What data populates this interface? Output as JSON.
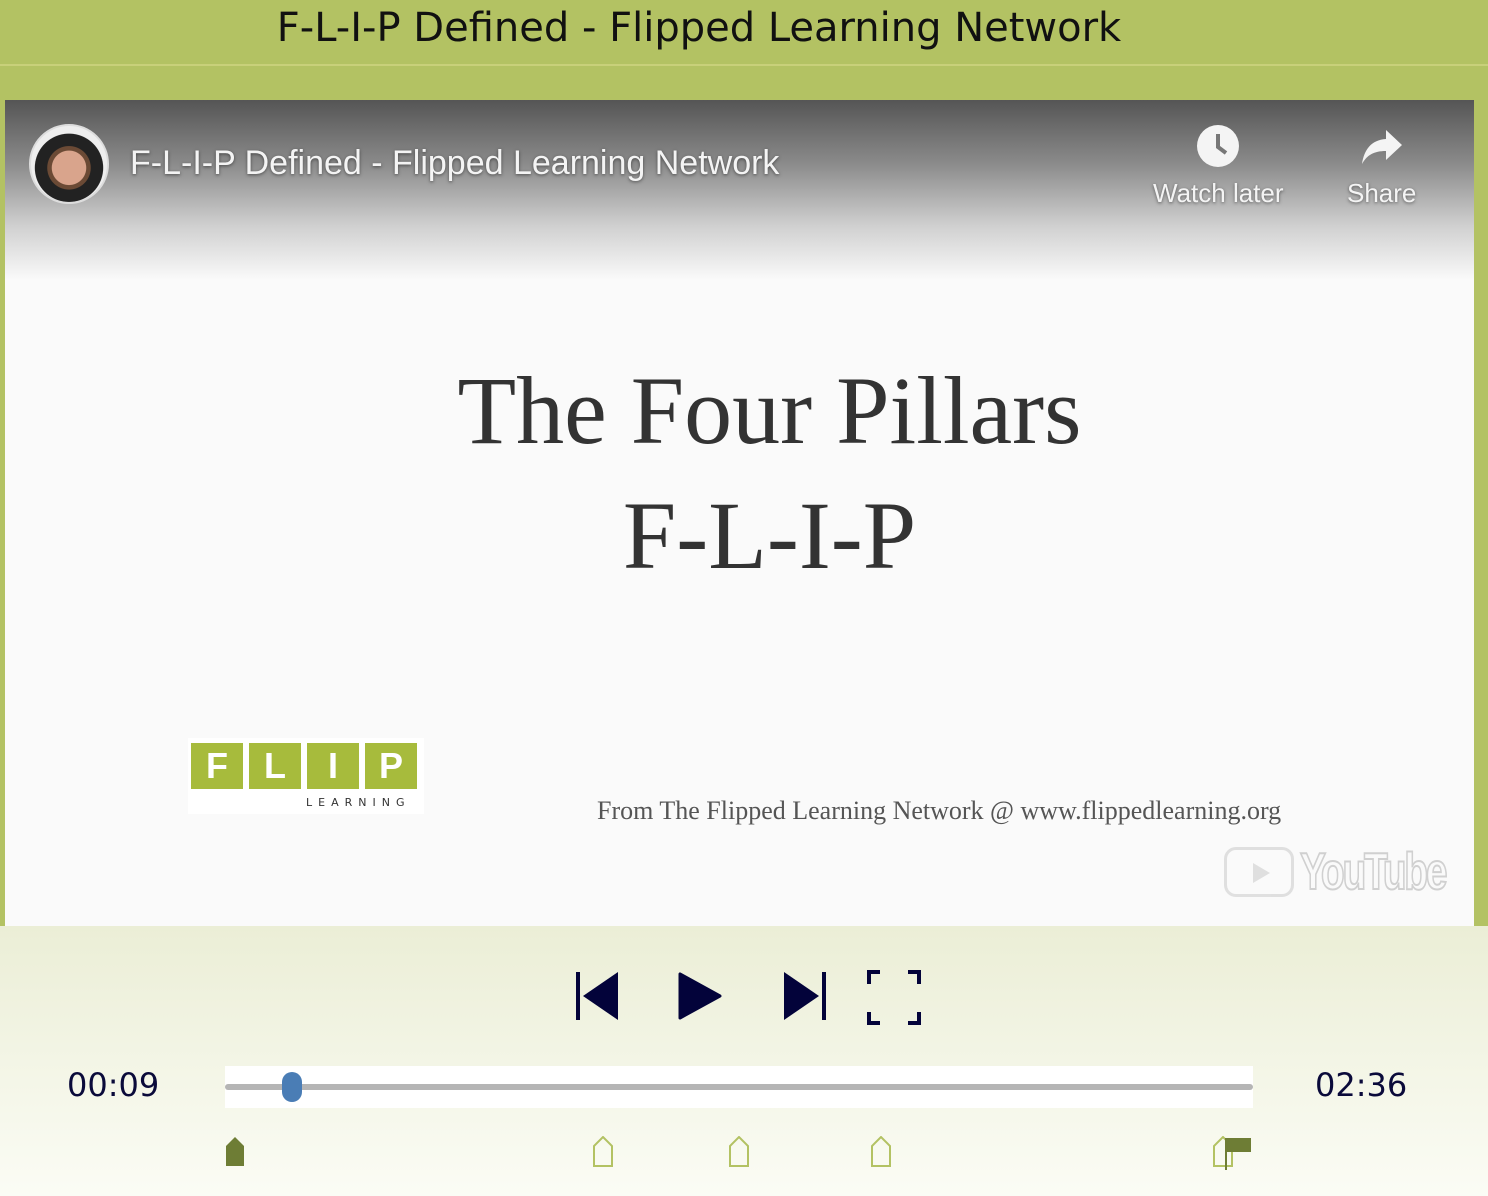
{
  "page_title": "F-L-I-P Defined - Flipped Learning Network",
  "video": {
    "title": "F-L-I-P Defined - Flipped Learning Network",
    "watch_later_label": "Watch later",
    "share_label": "Share",
    "slide_line1": "The Four Pillars",
    "slide_line2": "F-L-I-P",
    "logo_letters": [
      "F",
      "L",
      "I",
      "P"
    ],
    "logo_subtext": "LEARNING",
    "credit": "From The Flipped Learning Network @ www.flippedlearning.org",
    "youtube_logo_text": "YouTube"
  },
  "player": {
    "current_time": "00:09",
    "duration": "02:36",
    "progress_fraction": 0.065,
    "thumb_color": "#4a7db5",
    "control_color": "#0a0a3a",
    "marker_color_active": "#6e7d35",
    "marker_color": "#b3c263",
    "icons": [
      "skip-back-icon",
      "play-icon",
      "skip-forward-icon",
      "fullscreen-icon"
    ]
  }
}
